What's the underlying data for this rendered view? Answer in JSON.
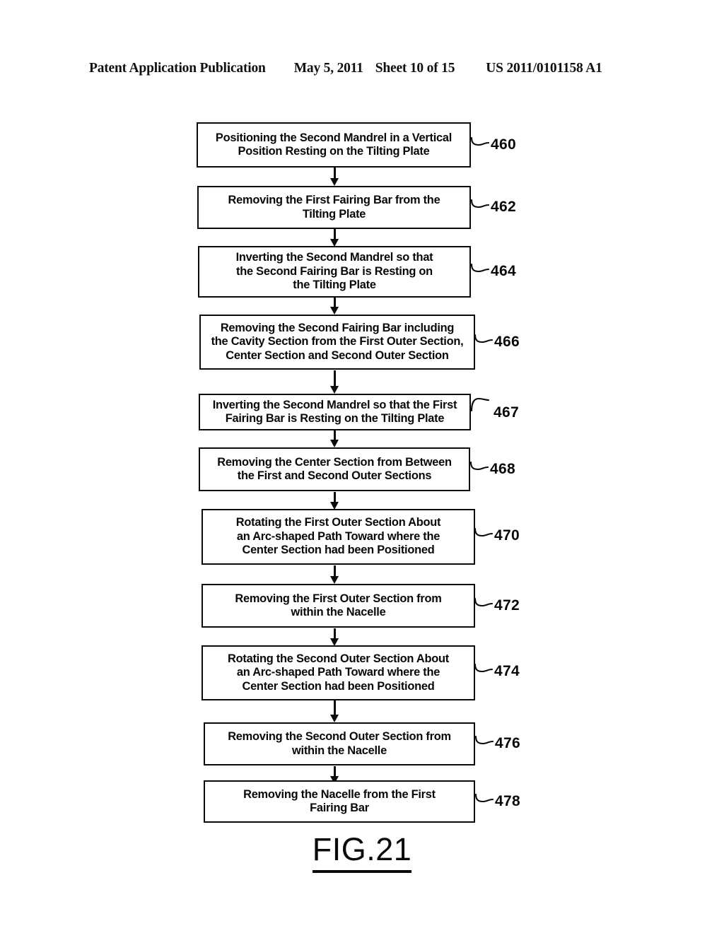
{
  "header": {
    "publication": "Patent Application Publication",
    "date": "May 5, 2011",
    "sheet": "Sheet 10 of 15",
    "patent_number": "US 2011/0101158 A1"
  },
  "figure": {
    "caption": "FIG.21",
    "type": "flowchart",
    "orientation": "vertical",
    "connector": "downward-arrow"
  },
  "flowchart": {
    "steps": [
      {
        "ref": "460",
        "text": "Positioning the Second Mandrel in a Vertical\nPosition Resting on the Tilting Plate"
      },
      {
        "ref": "462",
        "text": "Removing the First Fairing Bar from the\nTilting Plate"
      },
      {
        "ref": "464",
        "text": "Inverting the Second Mandrel so that\nthe Second Fairing Bar is Resting on\nthe Tilting Plate"
      },
      {
        "ref": "466",
        "text": "Removing the Second Fairing Bar including\nthe Cavity Section from the First Outer Section,\nCenter Section and Second Outer Section"
      },
      {
        "ref": "467",
        "text": "Inverting the Second Mandrel so that the First\nFairing Bar is Resting on the Tilting Plate"
      },
      {
        "ref": "468",
        "text": "Removing the Center Section from Between\nthe First and Second Outer Sections"
      },
      {
        "ref": "470",
        "text": "Rotating the First Outer Section About\nan Arc-shaped Path Toward where the\nCenter Section had been Positioned"
      },
      {
        "ref": "472",
        "text": "Removing the First Outer Section from\nwithin the Nacelle"
      },
      {
        "ref": "474",
        "text": "Rotating the Second Outer Section About\nan Arc-shaped Path Toward where the\nCenter Section had been Positioned"
      },
      {
        "ref": "476",
        "text": "Removing the Second Outer Section from\nwithin the Nacelle"
      },
      {
        "ref": "478",
        "text": "Removing the Nacelle from the First\nFairing Bar"
      }
    ]
  }
}
